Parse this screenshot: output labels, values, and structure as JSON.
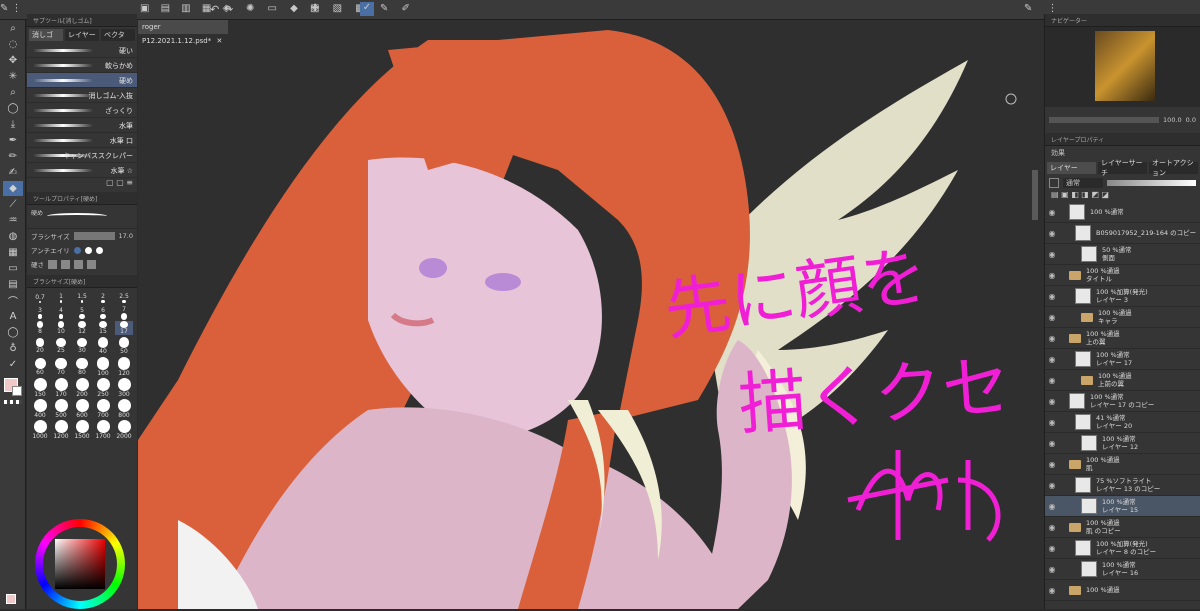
{
  "document_tab": {
    "title": "roger P12.2021.1.12.psd*"
  },
  "sub_tool": {
    "header": "サブツール[消しゴム]",
    "tabs": [
      "消しゴ",
      "レイヤー",
      "ベクタ"
    ],
    "brushes": [
      {
        "label": "硬い"
      },
      {
        "label": "軟らかめ"
      },
      {
        "label": "硬め",
        "selected": true
      },
      {
        "label": "消しゴム-入抜"
      },
      {
        "label": "ざっくり"
      },
      {
        "label": "水筆"
      },
      {
        "label": "水筆 口"
      },
      {
        "label": "キャンバススクレパー"
      },
      {
        "label": "水筆 ☆"
      }
    ]
  },
  "tool_property": {
    "header": "ツールプロパティ[硬め]",
    "preset_label": "硬め",
    "brush_size_label": "ブラシサイズ",
    "brush_size_value": "17.0",
    "antialias_label": "アンチエイリ",
    "hardness_label": "硬さ"
  },
  "brush_size_palette": {
    "header": "ブラシサイズ[硬め]",
    "sizes": [
      "0.7",
      "1",
      "1.5",
      "2",
      "2.5",
      "3",
      "4",
      "5",
      "6",
      "7",
      "8",
      "10",
      "12",
      "15",
      "17",
      "20",
      "25",
      "30",
      "40",
      "50",
      "60",
      "70",
      "80",
      "100",
      "120",
      "150",
      "170",
      "200",
      "250",
      "300",
      "400",
      "500",
      "600",
      "700",
      "800",
      "1000",
      "1200",
      "1500",
      "1700",
      "2000"
    ]
  },
  "navigator": {
    "header": "ナビゲーター",
    "zoom": "100.0",
    "angle": "0.0"
  },
  "layer_property": {
    "header": "レイヤープロパティ",
    "effect_label": "効果"
  },
  "layer_panel": {
    "tabs": [
      "レイヤー",
      "レイヤーサーチ",
      "オートアクション"
    ],
    "blend_mode": "通常",
    "layers": [
      {
        "line1": "100 %通常",
        "line2": "",
        "kind": "raster"
      },
      {
        "line1": "B059017952_219-164 のコピー",
        "line2": "",
        "kind": "raster"
      },
      {
        "line1": "50 %通常",
        "line2": "側面",
        "kind": "raster"
      },
      {
        "line1": "100 %通過",
        "line2": "タイトル",
        "kind": "folder"
      },
      {
        "line1": "100 %加算(発光)",
        "line2": "レイヤー 3",
        "kind": "raster"
      },
      {
        "line1": "100 %通過",
        "line2": "キャラ",
        "kind": "folder"
      },
      {
        "line1": "100 %通過",
        "line2": "上の翼",
        "kind": "folder"
      },
      {
        "line1": "100 %通常",
        "line2": "レイヤー 17",
        "kind": "raster"
      },
      {
        "line1": "100 %通過",
        "line2": "上前の翼",
        "kind": "folder"
      },
      {
        "line1": "100 %通常",
        "line2": "レイヤー 17 のコピー",
        "kind": "raster"
      },
      {
        "line1": "41 %通常",
        "line2": "レイヤー 20",
        "kind": "raster"
      },
      {
        "line1": "100 %通常",
        "line2": "レイヤー 12",
        "kind": "raster"
      },
      {
        "line1": "100 %通過",
        "line2": "肌",
        "kind": "folder"
      },
      {
        "line1": "75 %ソフトライト",
        "line2": "レイヤー 13 のコピー",
        "kind": "raster"
      },
      {
        "line1": "100 %通常",
        "line2": "レイヤー 15",
        "kind": "raster",
        "selected": true
      },
      {
        "line1": "100 %通過",
        "line2": "肌 のコピー",
        "kind": "folder"
      },
      {
        "line1": "100 %加算(発光)",
        "line2": "レイヤー 8 のコピー",
        "kind": "raster"
      },
      {
        "line1": "100 %通常",
        "line2": "レイヤー 16",
        "kind": "raster"
      },
      {
        "line1": "100 %通過",
        "line2": "",
        "kind": "folder"
      }
    ]
  },
  "canvas": {
    "annotation_line1": "先に顔を",
    "annotation_line2": "描くクセ"
  },
  "colors": {
    "accent": "#4a6fa5",
    "main_color": "#f0c8c8",
    "hair": "#d9603a",
    "wing": "#ece9d2"
  }
}
